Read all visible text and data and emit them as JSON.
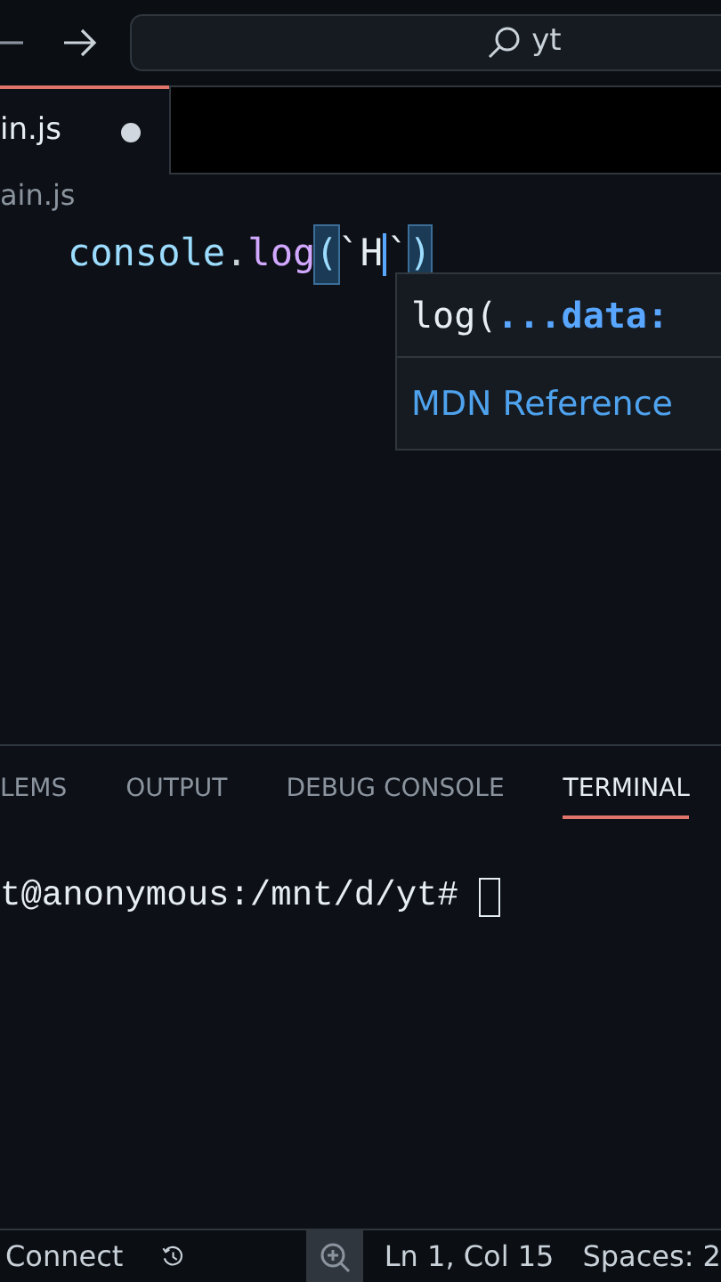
{
  "title_bar": {
    "search_text": "yt"
  },
  "tabs": [
    {
      "label": "in.js",
      "selected": true,
      "dirty": true
    }
  ],
  "breadcrumb": "ain.js",
  "code_line": [
    {
      "kind": "object",
      "text": "console"
    },
    {
      "kind": "plain",
      "text": "."
    },
    {
      "kind": "method",
      "text": "log"
    },
    {
      "kind": "bracket",
      "text": "("
    },
    {
      "kind": "string",
      "text": "`H"
    },
    {
      "kind": "cursor"
    },
    {
      "kind": "string",
      "text": "`"
    },
    {
      "kind": "bracket",
      "text": ")"
    }
  ],
  "hover": {
    "signature": "log(**...data:**",
    "link": "MDN Reference"
  },
  "panel_tabs": [
    {
      "label": "LEMS",
      "selected": false
    },
    {
      "label": "OUTPUT",
      "selected": false
    },
    {
      "label": "DEBUG CONSOLE",
      "selected": false
    },
    {
      "label": "TERMINAL",
      "selected": true
    }
  ],
  "terminal": {
    "prompt": "t@anonymous:/mnt/d/yt# "
  },
  "status_bar": {
    "connect": "Connect",
    "position": "Ln 1, Col 15",
    "spaces": "Spaces: 2"
  }
}
